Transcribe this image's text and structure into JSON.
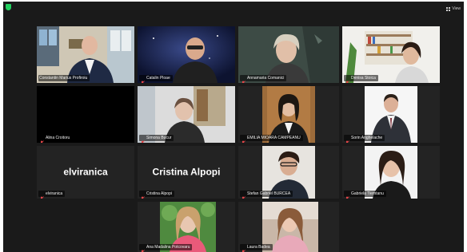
{
  "app": {
    "view_label": "View",
    "active_speaker_color": "#c7e25a",
    "muted_color": "#e8474a",
    "background_color": "#1a1a1a"
  },
  "participants": [
    {
      "name": "Constantin Marius Profiroiu",
      "muted": false
    },
    {
      "name": "Catalin Ploae",
      "muted": true
    },
    {
      "name": "Annamaria Comanici",
      "muted": true,
      "speaking": true
    },
    {
      "name": "Denisa Stoica",
      "muted": true
    },
    {
      "name": "Alina Croitoru",
      "muted": true
    },
    {
      "name": "Simona Bucur",
      "muted": true
    },
    {
      "name": "EMILIA MIOARA CAMPEANU",
      "muted": true
    },
    {
      "name": "Sorin Anghelache",
      "muted": true
    },
    {
      "name": "elviranica",
      "muted": true,
      "display_text": "elviranica"
    },
    {
      "name": "Cristina Alpopi",
      "muted": true,
      "display_text": "Cristina Alpopi"
    },
    {
      "name": "Stefan Gabriel BURCEA",
      "muted": true
    },
    {
      "name": "Gabriela Tiemtanu",
      "muted": true
    },
    {
      "name": "Ana Madalina Potcovaru",
      "muted": true
    },
    {
      "name": "Laura Badea",
      "muted": true
    }
  ]
}
